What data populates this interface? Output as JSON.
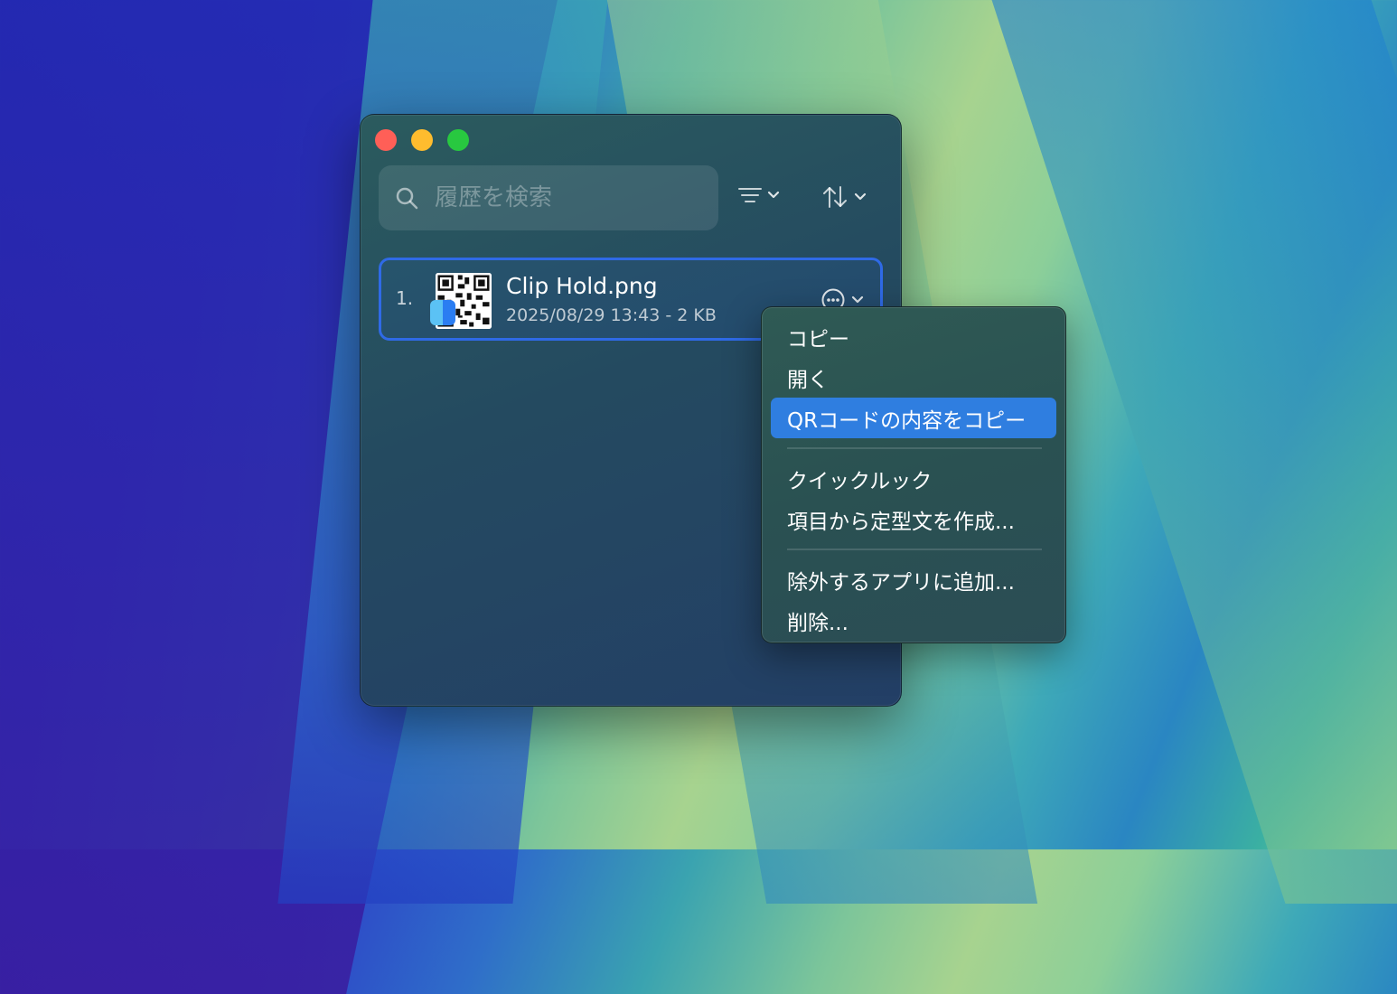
{
  "search": {
    "placeholder": "履歴を検索"
  },
  "toolbar": {
    "filter_icon": "filter-lines-icon",
    "sort_icon": "sort-arrows-icon"
  },
  "items": [
    {
      "index": "1.",
      "name": "Clip Hold.png",
      "meta": "2025/08/29 13:43  -  2 KB",
      "thumbnail": "qr-code-thumbnail",
      "app_icon": "finder-icon"
    }
  ],
  "context_menu": {
    "items": [
      {
        "label": "コピー"
      },
      {
        "label": "開く"
      },
      {
        "label": "QRコードの内容をコピー",
        "highlighted": true
      },
      {
        "label": "クイックルック"
      },
      {
        "label": "項目から定型文を作成..."
      },
      {
        "label": "除外するアプリに追加..."
      },
      {
        "label": "削除..."
      }
    ]
  },
  "colors": {
    "selection": "#2f6ae6",
    "menu_highlight": "#2f7ee0",
    "close": "#ff5f57",
    "minimize": "#febc2e",
    "zoom": "#28c840"
  }
}
